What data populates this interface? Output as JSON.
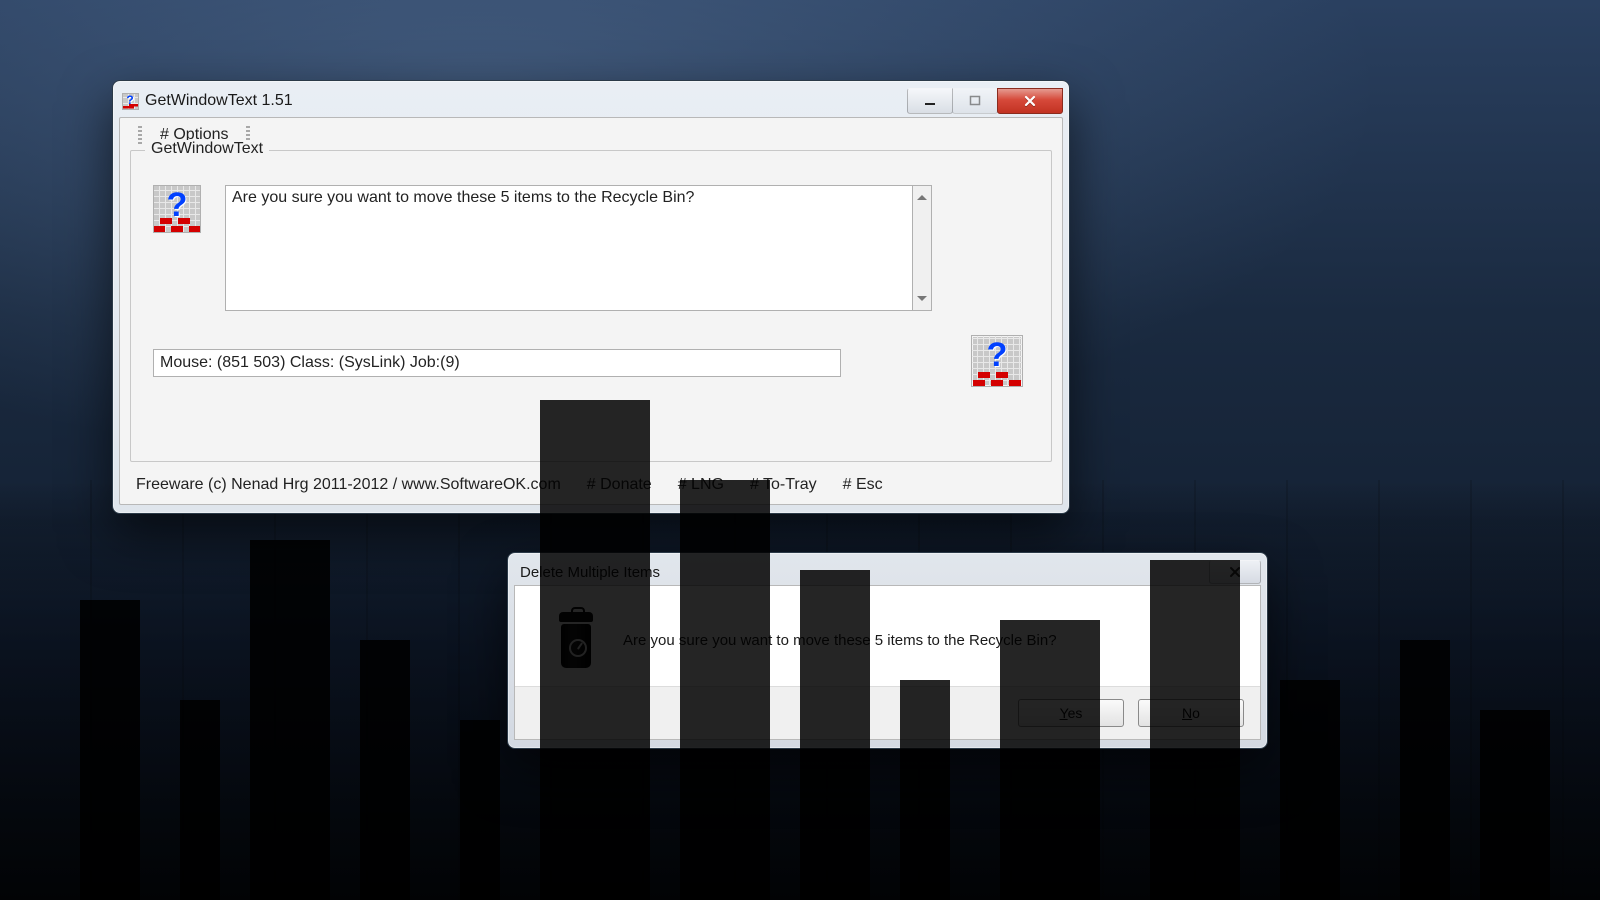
{
  "window_main": {
    "title": "GetWindowText 1.51",
    "menu": {
      "options": "# Options"
    },
    "group_label": "GetWindowText",
    "captured_text": "Are you sure you want to move these 5 items to the Recycle Bin?",
    "status_line": "Mouse: (851 503) Class: (SysLink) Job:(9)",
    "footer": {
      "copyright": "Freeware (c) Nenad Hrg 2011-2012 / www.SoftwareOK.com",
      "donate": "# Donate",
      "lng": "# LNG",
      "totray": "# To-Tray",
      "esc": "# Esc"
    }
  },
  "window_dialog": {
    "title": "Delete Multiple Items",
    "message": "Are you sure you want to move these 5 items to the Recycle Bin?",
    "yes": "Yes",
    "no": "No"
  }
}
